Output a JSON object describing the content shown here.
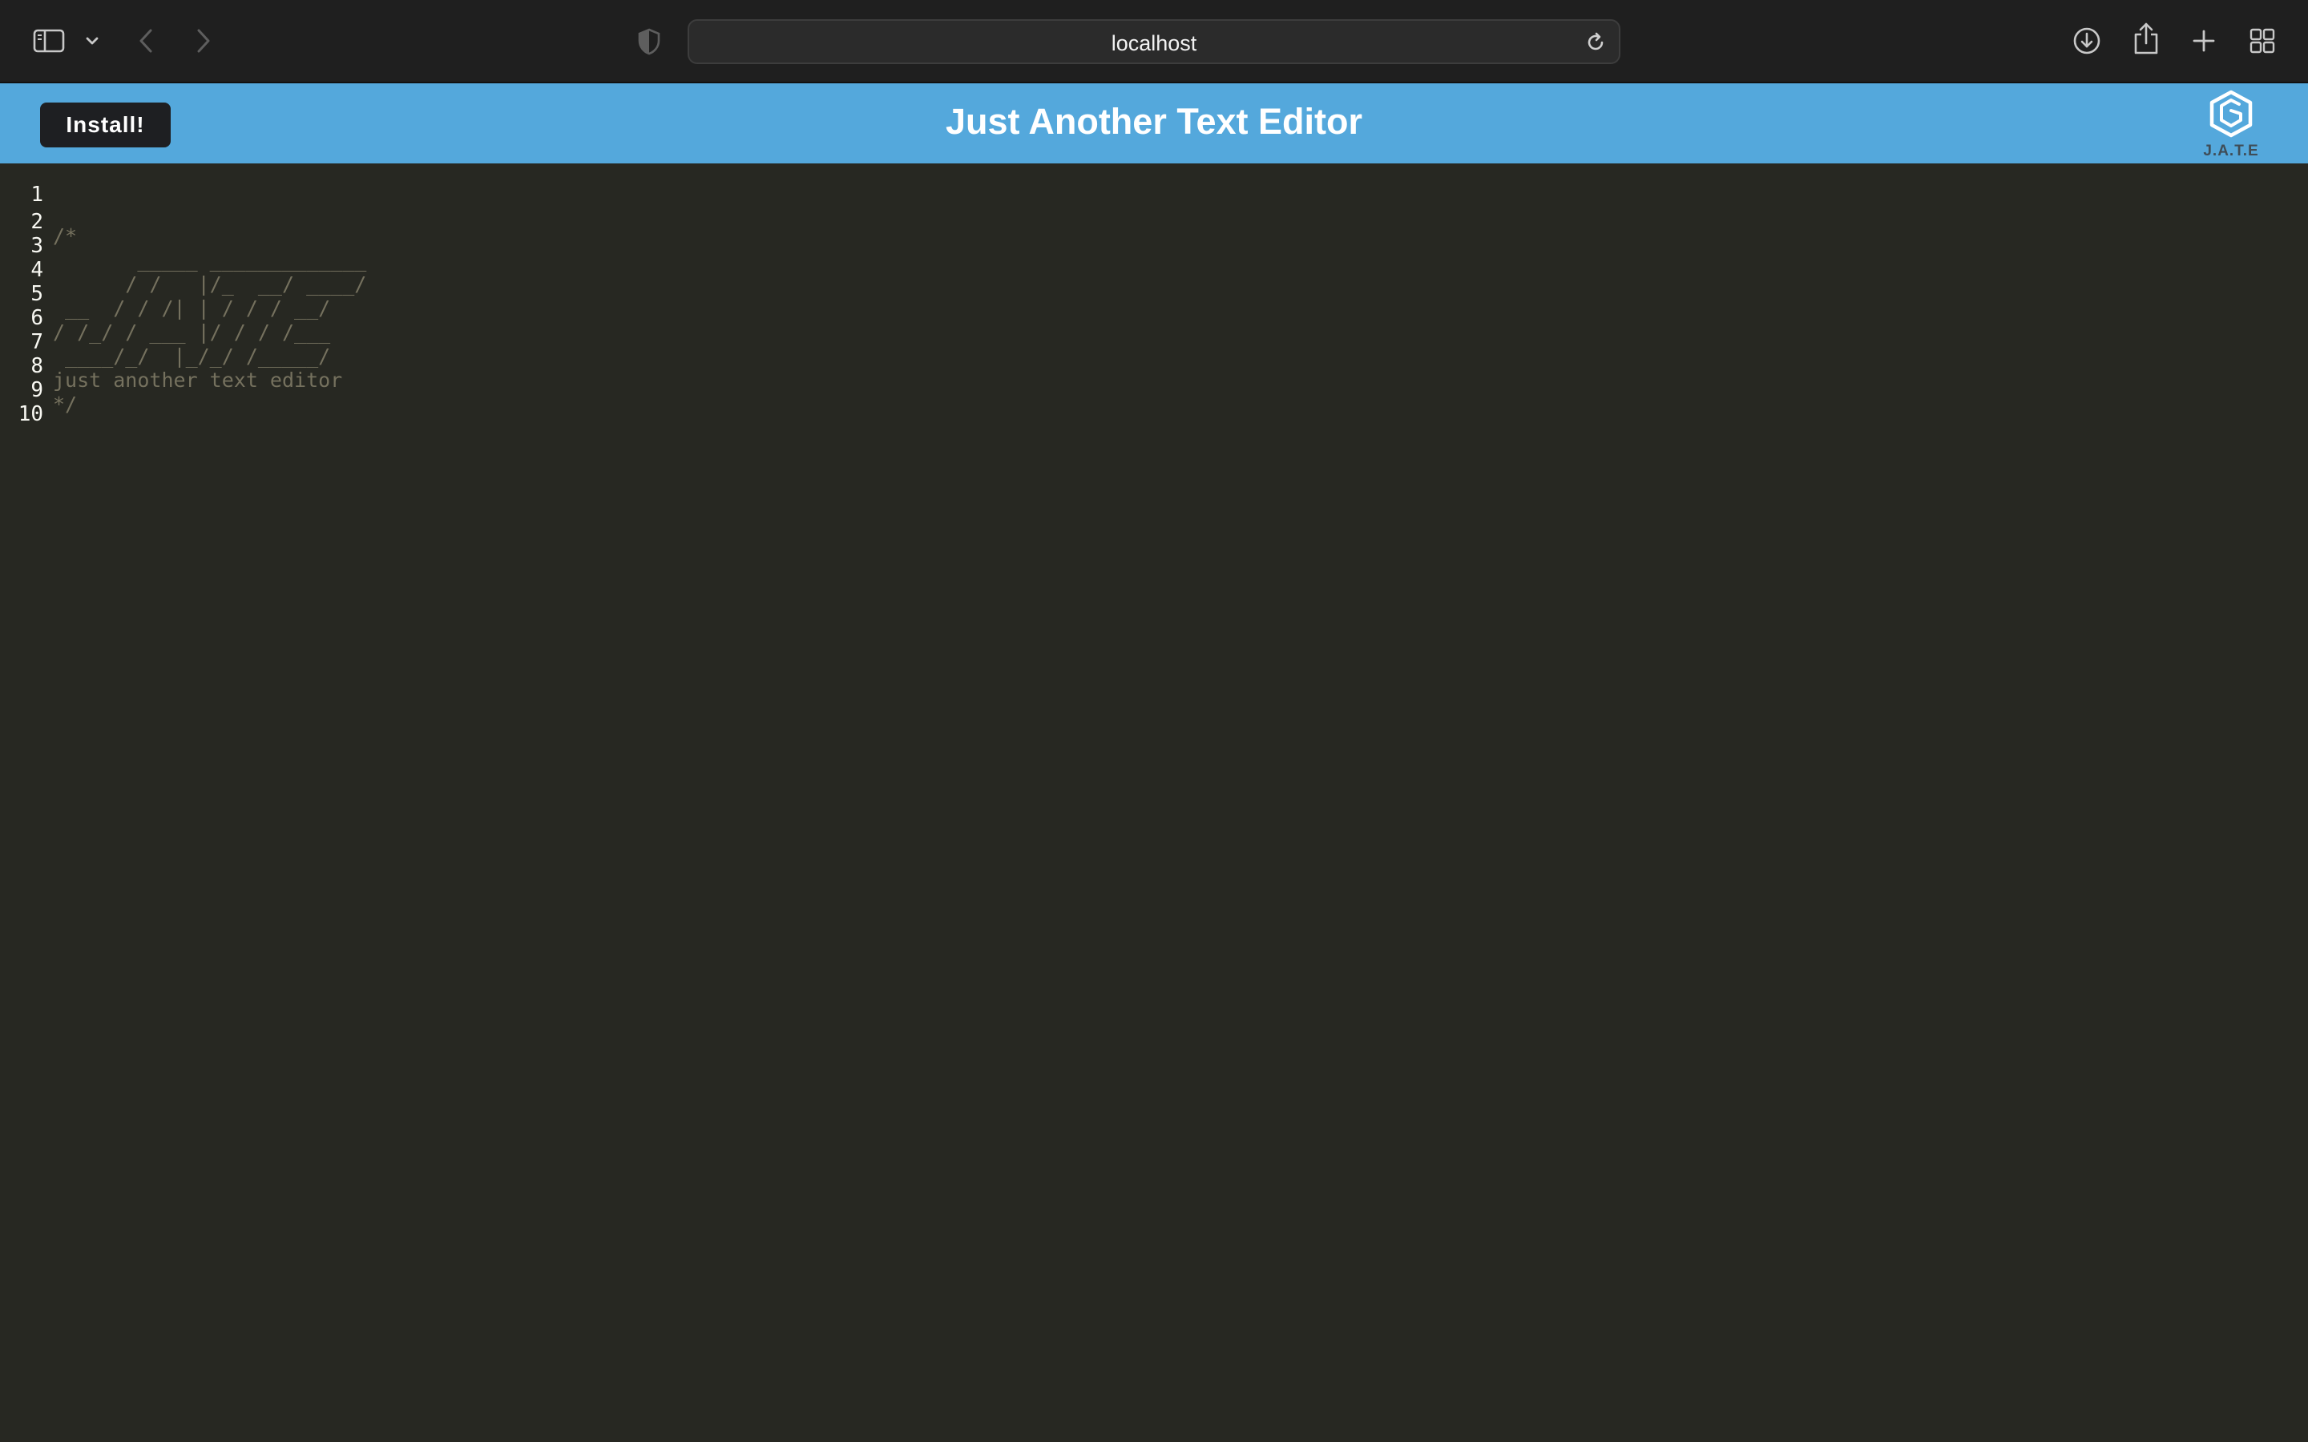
{
  "browser": {
    "url": "localhost",
    "icons": {
      "sidebar": "sidebar-icon",
      "chevron": "chevron-down-icon",
      "back": "back-arrow-icon",
      "forward": "forward-arrow-icon",
      "privacy": "shield-icon",
      "reload": "reload-icon",
      "download": "download-icon",
      "share": "share-icon",
      "new_tab": "plus-icon",
      "tab_overview": "grid-icon"
    }
  },
  "header": {
    "install_label": "Install!",
    "title": "Just Another Text Editor",
    "logo_text": "J.A.T.E",
    "background_color": "#54a8dc"
  },
  "editor": {
    "theme_background": "#272822",
    "comment_color": "#75715e",
    "lines": [
      {
        "number": "1",
        "text": ""
      },
      {
        "number": "2",
        "text": "/*"
      },
      {
        "number": "3",
        "text": "       _____ _____________"
      },
      {
        "number": "4",
        "text": "      / /   |/_  __/ ____/"
      },
      {
        "number": "5",
        "text": " __  / / /| | / / / __/"
      },
      {
        "number": "6",
        "text": "/ /_/ / ___ |/ / / /___"
      },
      {
        "number": "7",
        "text": " ____/_/  |_/_/ /_____/"
      },
      {
        "number": "8",
        "text": "just another text editor"
      },
      {
        "number": "9",
        "text": "*/"
      },
      {
        "number": "10",
        "text": ""
      }
    ]
  }
}
